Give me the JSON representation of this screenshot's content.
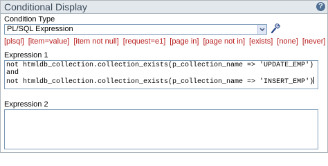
{
  "panel": {
    "title": "Conditional Display",
    "help_glyph": "?"
  },
  "condition_type": {
    "label": "Condition Type",
    "selected": "PL/SQL Expression",
    "shortcuts": [
      "[plsql]",
      "[item=value]",
      "[item not null]",
      "[request=e1]",
      "[page in]",
      "[page not in]",
      "[exists]",
      "[none]",
      "[never]"
    ]
  },
  "expression1": {
    "label": "Expression 1",
    "lines": [
      "not htmldb_collection.collection_exists(p_collection_name => 'UPDATE_EMP')",
      "and",
      "not htmldb_collection.collection_exists(p_collection_name => 'INSERT_EMP')"
    ]
  },
  "expression2": {
    "label": "Expression 2",
    "value": ""
  },
  "icons": {
    "help": "help-icon",
    "dropdown": "chevron-down-icon",
    "picker": "flashlight-icon"
  },
  "colors": {
    "header_bg": "#e3e8ec",
    "shortcut_link": "#b71a1a",
    "border": "#aeb7bd"
  }
}
